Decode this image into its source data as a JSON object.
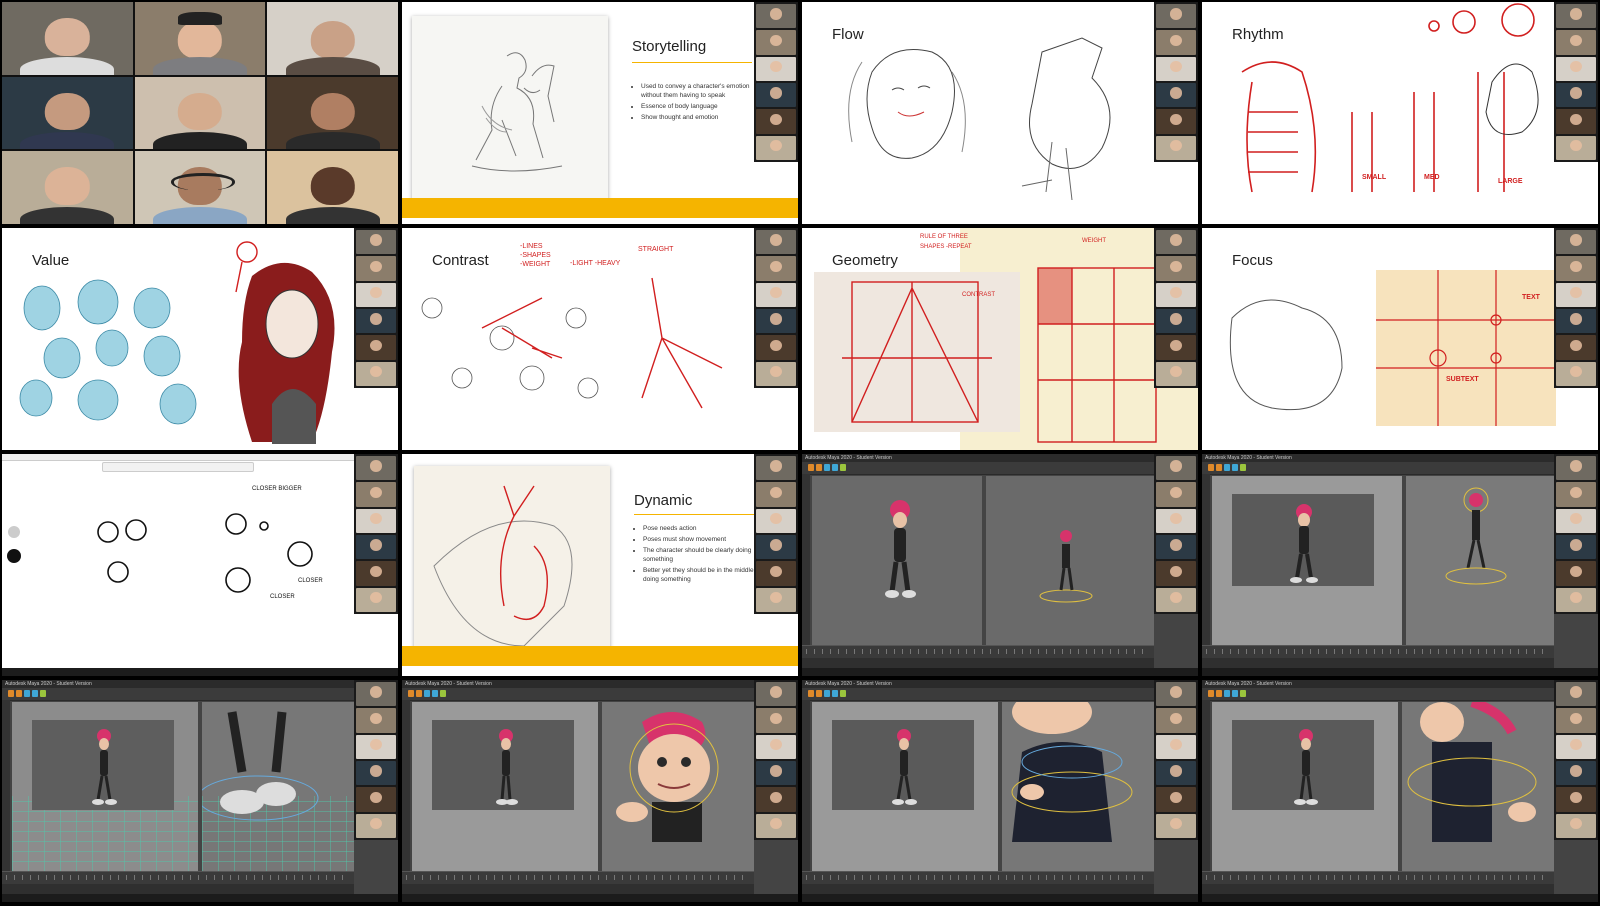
{
  "slides": {
    "storytelling": {
      "title": "Storytelling",
      "bullets": [
        "Used to convey a character's emotion without them having to speak",
        "Essence of body language",
        "Show thought and emotion"
      ]
    },
    "flow": {
      "title": "Flow"
    },
    "rhythm": {
      "title": "Rhythm",
      "labels": [
        "SMALL",
        "MED",
        "LARGE"
      ]
    },
    "value": {
      "title": "Value"
    },
    "contrast": {
      "title": "Contrast",
      "notes": [
        "-LINES",
        "-SHAPES",
        "-WEIGHT",
        "-LIGHT",
        "-HEAVY"
      ],
      "label_straight": "STRAIGHT"
    },
    "geometry": {
      "title": "Geometry",
      "notes": [
        "RULE OF THREE",
        "SHAPES",
        "-REPEAT"
      ],
      "label_weight": "WEIGHT",
      "label_contrast": "CONTRAST"
    },
    "focus": {
      "title": "Focus",
      "label_text": "TEXT",
      "label_subtext": "SUBTEXT"
    },
    "whiteboard": {
      "labels": [
        "CLOSER BIGGER",
        "CLOSER",
        "CLOSER"
      ]
    },
    "dynamic": {
      "title": "Dynamic",
      "bullets": [
        "Pose needs action",
        "Poses must show movement",
        "The character should be clearly doing something",
        "Better yet they should be in the middle of doing something"
      ]
    }
  },
  "maya": {
    "window_title": "Autodesk Maya 2020 - Student Version"
  },
  "colors": {
    "accent_yellow": "#f5b400",
    "sketch_red": "#d11f1f",
    "maya_bg": "#444444",
    "viewport_gray": "#6f6f6f"
  }
}
